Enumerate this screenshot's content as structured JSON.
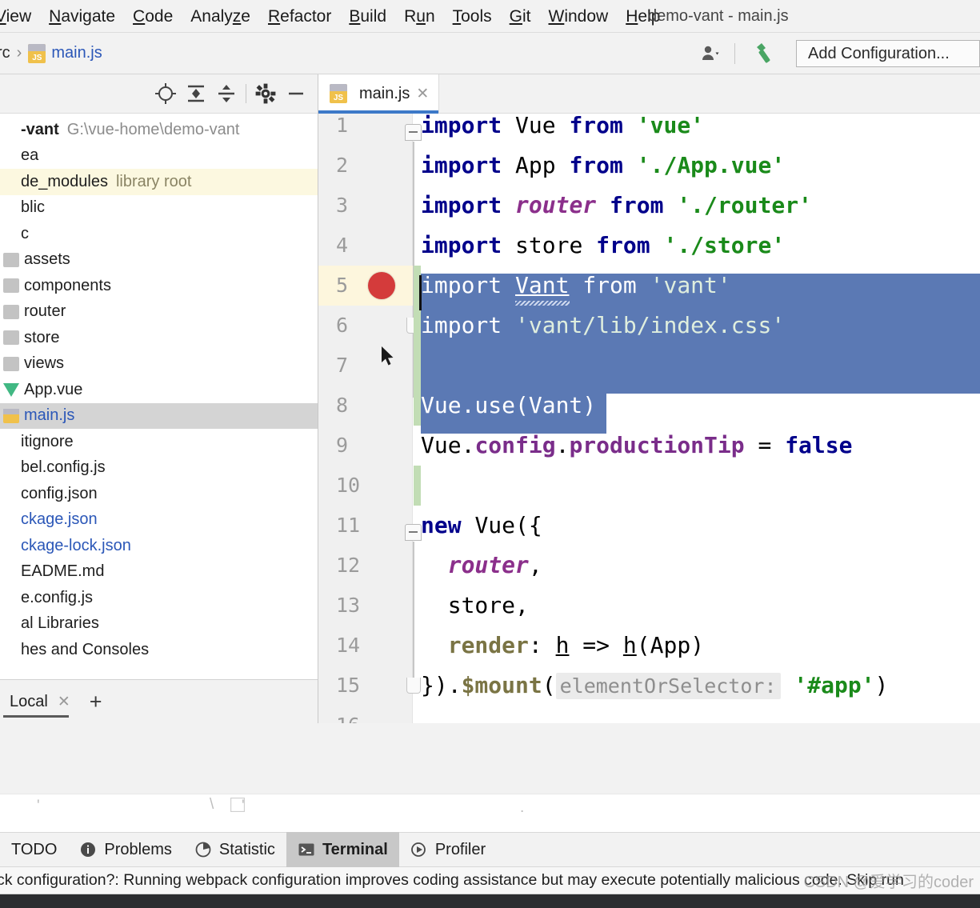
{
  "window": {
    "title": "demo-vant - main.js"
  },
  "menubar": {
    "items": [
      {
        "label": "View",
        "mnemonic": "V"
      },
      {
        "label": "Navigate",
        "mnemonic": "N"
      },
      {
        "label": "Code",
        "mnemonic": "C"
      },
      {
        "label": "Analyze",
        "mnemonic": "z"
      },
      {
        "label": "Refactor",
        "mnemonic": "R"
      },
      {
        "label": "Build",
        "mnemonic": "B"
      },
      {
        "label": "Run",
        "mnemonic": "u"
      },
      {
        "label": "Tools",
        "mnemonic": "T"
      },
      {
        "label": "Git",
        "mnemonic": "G"
      },
      {
        "label": "Window",
        "mnemonic": "W"
      },
      {
        "label": "Help",
        "mnemonic": "H"
      }
    ]
  },
  "breadcrumb": {
    "root": "src",
    "separator": "›",
    "file": "main.js",
    "file_icon": "js-file-icon"
  },
  "navbar": {
    "vcs_label": "",
    "build_icon": "hammer-icon",
    "user_icon": "user-icon",
    "add_configuration": "Add Configuration..."
  },
  "project_panel": {
    "toolbar_icons": [
      "locate-target-icon",
      "collapse-all-icon",
      "expand-all-icon",
      "settings-gear-icon",
      "hide-minimize-icon"
    ],
    "tree": [
      {
        "label": "demo-vant",
        "path": "G:\\vue-home\\demo-vant",
        "icon": "folder",
        "bold": true,
        "indent": 0,
        "highlight": "none",
        "truncated": "-vant"
      },
      {
        "label": ".idea",
        "icon": "folder",
        "indent": 1,
        "highlight": "none",
        "truncated": "ea"
      },
      {
        "label": "node_modules",
        "tag": "library root",
        "icon": "folder",
        "indent": 1,
        "highlight": "yellow",
        "truncated": "de_modules"
      },
      {
        "label": "public",
        "icon": "folder",
        "indent": 1,
        "highlight": "none",
        "truncated": "blic"
      },
      {
        "label": "src",
        "icon": "folder",
        "indent": 1,
        "highlight": "none",
        "truncated": "c"
      },
      {
        "label": "assets",
        "icon": "folder",
        "indent": 2,
        "highlight": "none",
        "truncated": "assets"
      },
      {
        "label": "components",
        "icon": "folder",
        "indent": 2,
        "highlight": "none",
        "truncated": "components"
      },
      {
        "label": "router",
        "icon": "folder",
        "indent": 2,
        "highlight": "none",
        "truncated": "router"
      },
      {
        "label": "store",
        "icon": "folder",
        "indent": 2,
        "highlight": "none",
        "truncated": "store"
      },
      {
        "label": "views",
        "icon": "folder",
        "indent": 2,
        "highlight": "none",
        "truncated": "views"
      },
      {
        "label": "App.vue",
        "icon": "vue",
        "indent": 2,
        "highlight": "none",
        "truncated": "App.vue"
      },
      {
        "label": "main.js",
        "icon": "js",
        "indent": 2,
        "highlight": "selected",
        "blue": true,
        "truncated": "main.js"
      },
      {
        "label": ".gitignore",
        "icon": "file",
        "indent": 1,
        "highlight": "none",
        "truncated": "itignore"
      },
      {
        "label": "babel.config.js",
        "icon": "file",
        "indent": 1,
        "highlight": "none",
        "truncated": "bel.config.js"
      },
      {
        "label": "jsconfig.json",
        "icon": "file",
        "indent": 1,
        "highlight": "none",
        "truncated": "config.json"
      },
      {
        "label": "package.json",
        "icon": "file",
        "indent": 1,
        "highlight": "none",
        "blue": true,
        "truncated": "ckage.json"
      },
      {
        "label": "package-lock.json",
        "icon": "file",
        "indent": 1,
        "highlight": "none",
        "blue": true,
        "truncated": "ckage-lock.json"
      },
      {
        "label": "README.md",
        "icon": "file",
        "indent": 1,
        "highlight": "none",
        "truncated": "EADME.md"
      },
      {
        "label": "vue.config.js",
        "icon": "file",
        "indent": 1,
        "highlight": "none",
        "truncated": "e.config.js"
      },
      {
        "label": "External Libraries",
        "icon": "lib",
        "indent": 0,
        "highlight": "none",
        "truncated": "al Libraries"
      },
      {
        "label": "Scratches and Consoles",
        "icon": "scratch",
        "indent": 0,
        "highlight": "none",
        "truncated": "hes and Consoles"
      }
    ]
  },
  "terminal_tabs": {
    "tabs": [
      {
        "label": "Local",
        "active": true,
        "close_icon": "close-icon"
      }
    ],
    "add_label": "+"
  },
  "editor": {
    "tabs": [
      {
        "label": "main.js",
        "icon": "js-file-icon",
        "active": true,
        "close_icon": "close-icon"
      }
    ],
    "first_visible_line": 1,
    "last_partial_line": "16",
    "breakpoint_line": 5,
    "caret_line": 5,
    "selection_lines": [
      5,
      6,
      7,
      8
    ],
    "parameter_hint": "elementOrSelector:",
    "lines": [
      {
        "n": "1",
        "text": "import Vue from 'vue'"
      },
      {
        "n": "2",
        "text": "import App from './App.vue'"
      },
      {
        "n": "3",
        "text": "import router from './router'"
      },
      {
        "n": "4",
        "text": "import store from './store'"
      },
      {
        "n": "5",
        "text": "import Vant from 'vant'"
      },
      {
        "n": "6",
        "text": "import 'vant/lib/index.css'"
      },
      {
        "n": "7",
        "text": ""
      },
      {
        "n": "8",
        "text": "Vue.use(Vant)"
      },
      {
        "n": "9",
        "text": "Vue.config.productionTip = false"
      },
      {
        "n": "10",
        "text": ""
      },
      {
        "n": "11",
        "text": "new Vue({"
      },
      {
        "n": "12",
        "text": "  router,"
      },
      {
        "n": "13",
        "text": "  store,"
      },
      {
        "n": "14",
        "text": "  render: h => h(App)"
      },
      {
        "n": "15",
        "text": "}).$mount('#app')"
      },
      {
        "n": "16",
        "text": ""
      }
    ],
    "colors": {
      "keyword": "#00008b",
      "string": "#1a8a1a",
      "selection": "#5b79b4",
      "caret_line": "#fdf6dd",
      "breakpoint": "#d43b3b",
      "change_marker": "#c2ddb5",
      "tab_underline": "#3d79c8"
    }
  },
  "bottom_toolwindows": {
    "items": [
      {
        "label": "TODO",
        "icon": "todo-icon",
        "active": false
      },
      {
        "label": "Problems",
        "icon": "problems-icon",
        "active": false
      },
      {
        "label": "Statistic",
        "icon": "statistic-icon",
        "active": false
      },
      {
        "label": "Terminal",
        "icon": "terminal-icon",
        "active": true
      },
      {
        "label": "Profiler",
        "icon": "profiler-icon",
        "active": false
      }
    ]
  },
  "statusbar": {
    "message": "ck configuration?: Running webpack configuration improves coding assistance but may execute potentially malicious code. Skip run",
    "watermark": "CSDN @爱学习的coder"
  }
}
